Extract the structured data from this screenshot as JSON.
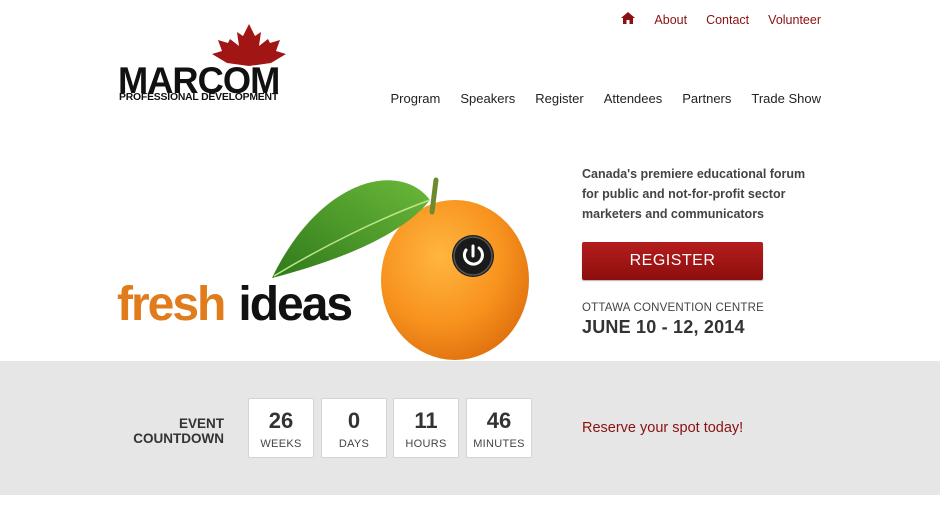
{
  "topnav": {
    "home_icon": "home-icon",
    "links": [
      "About",
      "Contact",
      "Volunteer"
    ]
  },
  "logo": {
    "word": "MARCOM",
    "subtitle": "PROFESSIONAL DEVELOPMENT",
    "emblem": "maple-leaf-icon"
  },
  "mainnav": {
    "items": [
      "Program",
      "Speakers",
      "Register",
      "Attendees",
      "Partners",
      "Trade Show"
    ]
  },
  "hero": {
    "word1": "fresh",
    "word2": "ideas",
    "art_icon": "orange-with-power-button",
    "blurb": "Canada's premiere educational forum for public and not-for-profit sector marketers and communicators",
    "register_label": "REGISTER",
    "venue": "OTTAWA CONVENTION CENTRE",
    "dates": "JUNE 10 - 12, 2014"
  },
  "countdown": {
    "label_line1": "EVENT",
    "label_line2": "COUNTDOWN",
    "units": [
      {
        "value": "26",
        "label": "WEEKS"
      },
      {
        "value": "0",
        "label": "DAYS"
      },
      {
        "value": "11",
        "label": "HOURS"
      },
      {
        "value": "46",
        "label": "MINUTES"
      }
    ],
    "cta": "Reserve your spot today!"
  },
  "colors": {
    "brand_red": "#8a1111",
    "accent_orange": "#e07c1b",
    "countdown_bg": "#e6e6e6"
  }
}
